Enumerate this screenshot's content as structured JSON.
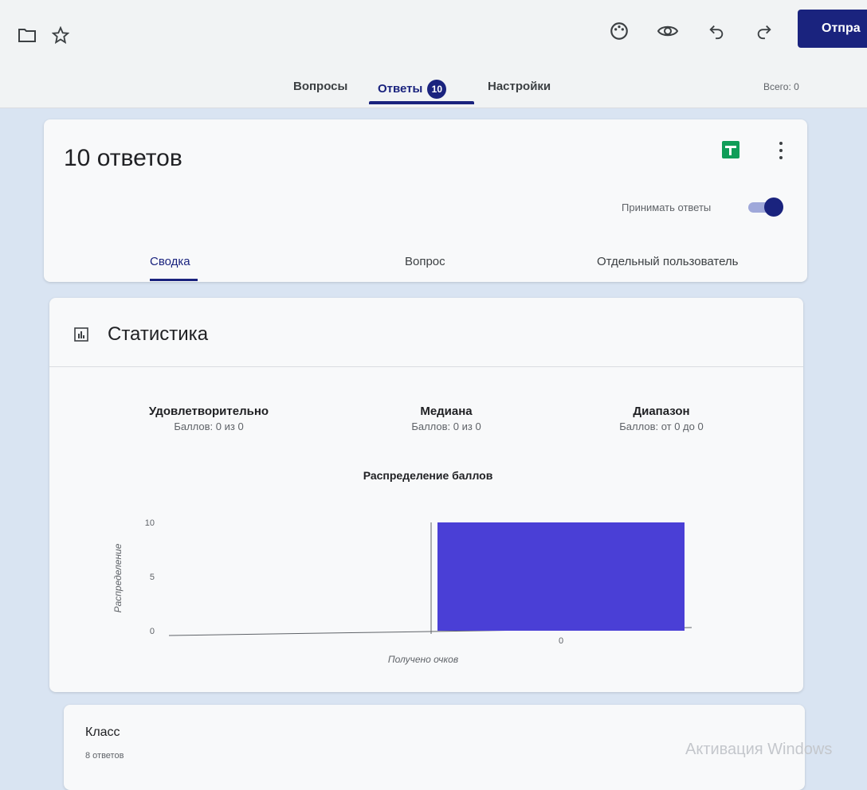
{
  "topbar": {
    "send_label": "Отпра",
    "icons": [
      "folder-icon",
      "star-icon",
      "palette-icon",
      "eye-icon",
      "undo-icon",
      "redo-icon"
    ]
  },
  "tabs": {
    "questions": "Вопросы",
    "answers": "Ответы",
    "answers_count": "10",
    "settings": "Настройки",
    "total": "Всего: 0"
  },
  "responses": {
    "title": "10 ответов",
    "accept_label": "Принимать ответы",
    "accepting": true,
    "subtabs": [
      "Сводка",
      "Вопрос",
      "Отдельный пользователь"
    ]
  },
  "stats": {
    "title": "Статистика",
    "metrics": [
      {
        "label": "Удовлетворительно",
        "value": "Баллов: 0 из 0"
      },
      {
        "label": "Медиана",
        "value": "Баллов: 0 из 0"
      },
      {
        "label": "Диапазон",
        "value": "Баллов: от 0 до 0"
      }
    ]
  },
  "chart_data": {
    "type": "bar",
    "title": "Распределение баллов",
    "xlabel": "Получено очков",
    "ylabel": "Распределение",
    "categories": [
      "0"
    ],
    "values": [
      10
    ],
    "yticks": [
      "0",
      "5",
      "10"
    ],
    "ylim": [
      0,
      10
    ],
    "bar_color": "#4a3fd6",
    "grid": false,
    "legend": "none"
  },
  "class_card": {
    "title": "Класс",
    "subtitle": "8 ответов"
  },
  "watermark": "Активация Windows",
  "colors": {
    "accent": "#1a237e",
    "bar": "#4a3fd6",
    "sheets": "#0f9d58"
  }
}
